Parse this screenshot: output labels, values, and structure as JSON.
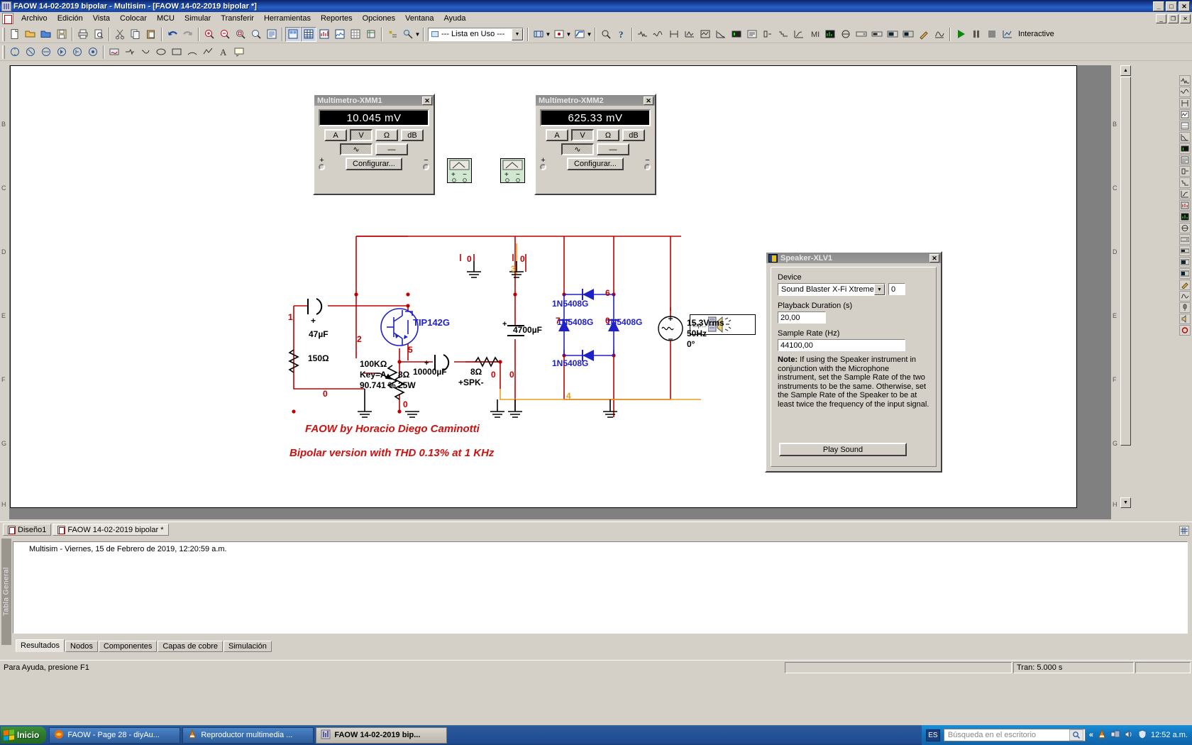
{
  "window": {
    "title": "FAOW 14-02-2019 bipolar - Multisim - [FAOW 14-02-2019 bipolar *]",
    "minimize": "_",
    "maximize": "□",
    "close": "✕",
    "doc_minimize": "_",
    "doc_restore": "❐",
    "doc_close": "✕"
  },
  "menu": {
    "items": [
      {
        "label": "Archivo"
      },
      {
        "label": "Edición"
      },
      {
        "label": "Vista"
      },
      {
        "label": "Colocar"
      },
      {
        "label": "MCU"
      },
      {
        "label": "Simular"
      },
      {
        "label": "Transferir"
      },
      {
        "label": "Herramientas"
      },
      {
        "label": "Reportes"
      },
      {
        "label": "Opciones"
      },
      {
        "label": "Ventana"
      },
      {
        "label": "Ayuda"
      }
    ]
  },
  "toolbar": {
    "inuse_list": "--- Lista en Uso ---",
    "interactive_label": "Interactive",
    "arrow_glyph": "▼"
  },
  "instruments": [
    {
      "id": "xmm1",
      "title": "Multímetro-XMM1",
      "reading": "10.045 mV",
      "mode_buttons": [
        "A",
        "V",
        "Ω",
        "dB"
      ],
      "mode_selected": "V",
      "wave_buttons": [
        "∿",
        "—"
      ],
      "wave_selected": "∿",
      "config_label": "Configurar...",
      "plus": "+",
      "minus": "−",
      "close": "✕"
    },
    {
      "id": "xmm2",
      "title": "Multímetro-XMM2",
      "reading": "625.33 mV",
      "mode_buttons": [
        "A",
        "V",
        "Ω",
        "dB"
      ],
      "mode_selected": "V",
      "wave_buttons": [
        "∿",
        "—"
      ],
      "wave_selected": "∿",
      "config_label": "Configurar...",
      "plus": "+",
      "minus": "−",
      "close": "✕"
    }
  ],
  "speaker_dialog": {
    "title": "Speaker-XLV1",
    "close": "✕",
    "device_label": "Device",
    "device_value": "Sound Blaster X-Fi Xtreme",
    "device_channel": "0",
    "duration_label": "Playback Duration (s)",
    "duration_value": "20,00",
    "samplerate_label": "Sample Rate (Hz)",
    "samplerate_value": "44100,00",
    "note_prefix": "Note:",
    "note_text": " If using the Speaker instrument in conjunction with the Microphone instrument, set the Sample Rate of the two instruments to be the same. Otherwise, set the Sample Rate of the Speaker to be at least twice the frequency of the input signal.",
    "play_label": "Play Sound",
    "dropdown_glyph": "▼"
  },
  "circuit": {
    "labels": {
      "c1": "47µF",
      "c1_plus": "+",
      "r1": "150Ω",
      "pot": "100KΩ",
      "pot_key": "Key=A",
      "pot_value": "90.741 %",
      "transistor": "TIP142G",
      "c_out": "10000µF",
      "c_out_plus": "+",
      "load": "8Ω",
      "load_w": "25W",
      "spk": "8Ω",
      "spk_name": "+SPK-",
      "c_psu": "4700µF",
      "c_psu_plus": "+",
      "d1": "1N5408G",
      "d2": "1N5408G",
      "d3": "1N5408G",
      "d4": "1N5408G",
      "src_v": "15.3Vrms",
      "src_f": "50Hz",
      "src_p": "0°",
      "spk_input": "Inp..."
    },
    "nodes": [
      "1",
      "2",
      "0",
      "5",
      "0",
      "0",
      "3",
      "6",
      "7",
      "0",
      "0",
      "4",
      "0"
    ],
    "captions": [
      "FAOW by Horacio Diego Caminotti",
      "Bipolar version with THD 0.13% at 1 KHz"
    ],
    "caption_color": "#cc1111"
  },
  "rulers": {
    "left": [
      "B",
      "C",
      "D",
      "E",
      "F",
      "G",
      "H"
    ],
    "right": [
      "B",
      "C",
      "D",
      "E",
      "F",
      "G",
      "H"
    ]
  },
  "sheet_tabs": [
    {
      "label": "Diseño1",
      "active": false
    },
    {
      "label": "FAOW 14-02-2019 bipolar *",
      "active": true
    }
  ],
  "results_pane": {
    "side_label": "Tabla General",
    "log_line": "Multisim  -  Viernes, 15 de Febrero de 2019, 12:20:59 a.m.",
    "tabs": [
      {
        "label": "Resultados",
        "active": true
      },
      {
        "label": "Nodos",
        "active": false
      },
      {
        "label": "Componentes",
        "active": false
      },
      {
        "label": "Capas de cobre",
        "active": false
      },
      {
        "label": "Simulación",
        "active": false
      }
    ]
  },
  "statusbar": {
    "help_text": "Para Ayuda, presione F1",
    "middle_cell": "",
    "tran": "Tran: 5.000 s"
  },
  "taskbar": {
    "start_label": "Inicio",
    "buttons": [
      {
        "label": "FAOW - Page 28 - diyAu...",
        "icon": "firefox-icon",
        "active": false
      },
      {
        "label": "Reproductor multimedia ...",
        "icon": "vlc-icon",
        "active": false
      },
      {
        "label": "FAOW 14-02-2019 bip...",
        "icon": "multisim-icon",
        "active": true
      }
    ],
    "lang": "ES",
    "search_placeholder": "Búsqueda en el escritorio",
    "chevron": "«",
    "clock": "12:52 a.m."
  }
}
